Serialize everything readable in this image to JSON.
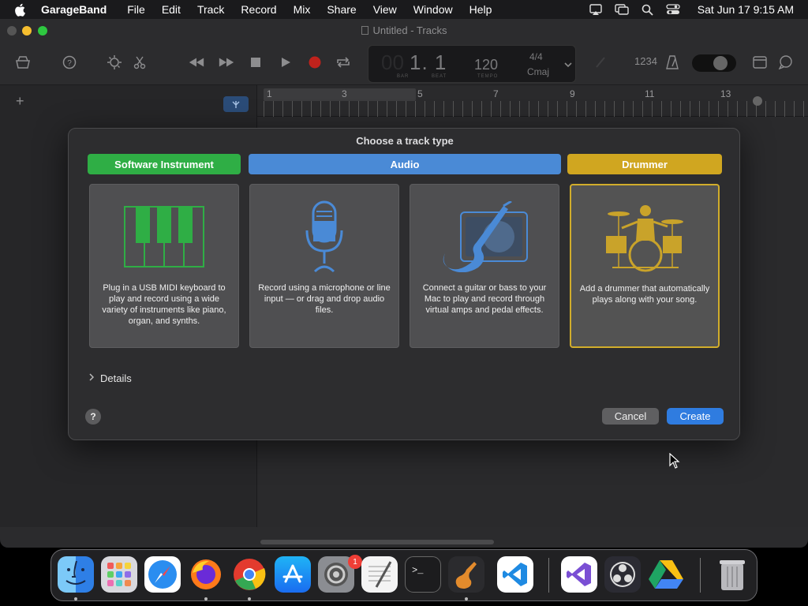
{
  "menubar": {
    "app_name": "GarageBand",
    "items": [
      "File",
      "Edit",
      "Track",
      "Record",
      "Mix",
      "Share",
      "View",
      "Window",
      "Help"
    ],
    "clock": "Sat Jun 17  9:15 AM",
    "status_icons": [
      "airplay-icon",
      "display-icon",
      "search-icon",
      "control-center-icon"
    ]
  },
  "window": {
    "title": "Untitled - Tracks",
    "lcd": {
      "bar_beat": "1. 1",
      "bar_label": "BAR",
      "beat_label": "BEAT",
      "tempo": "120",
      "tempo_label": "TEMPO",
      "time_signature": "4/4",
      "key": "Cmaj"
    },
    "count_in": "1234",
    "ruler_numbers": [
      "1",
      "3",
      "5",
      "7",
      "9",
      "11",
      "13"
    ],
    "add_track": "+"
  },
  "dialog": {
    "title": "Choose a track type",
    "categories": {
      "software_instrument": "Software Instrument",
      "audio": "Audio",
      "drummer": "Drummer"
    },
    "cards": [
      {
        "desc": "Plug in a USB MIDI keyboard to play and record using a wide variety of instruments like piano, organ, and synths.",
        "icon": "piano-keys-icon"
      },
      {
        "desc": "Record using a microphone or line input — or drag and drop audio files.",
        "icon": "microphone-icon"
      },
      {
        "desc": "Connect a guitar or bass to your Mac to play and record through virtual amps and pedal effects.",
        "icon": "guitar-amp-icon"
      },
      {
        "desc": "Add a drummer that automatically plays along with your song.",
        "icon": "drummer-icon"
      }
    ],
    "selected_card": 3,
    "details_label": "Details",
    "help": "?",
    "cancel": "Cancel",
    "create": "Create"
  },
  "dock": {
    "apps": [
      "Finder",
      "Launchpad",
      "Safari",
      "Firefox",
      "Chrome",
      "App Store",
      "System Settings",
      "TextEdit",
      "Terminal",
      "GarageBand",
      "VS Code",
      "Visual Studio",
      "OBS",
      "Google Drive",
      "Trash"
    ],
    "settings_badge": "1"
  },
  "colors": {
    "software_instrument": "#2fae45",
    "audio": "#4a8ad6",
    "drummer": "#d0a620",
    "create_button": "#2f7ce0"
  }
}
